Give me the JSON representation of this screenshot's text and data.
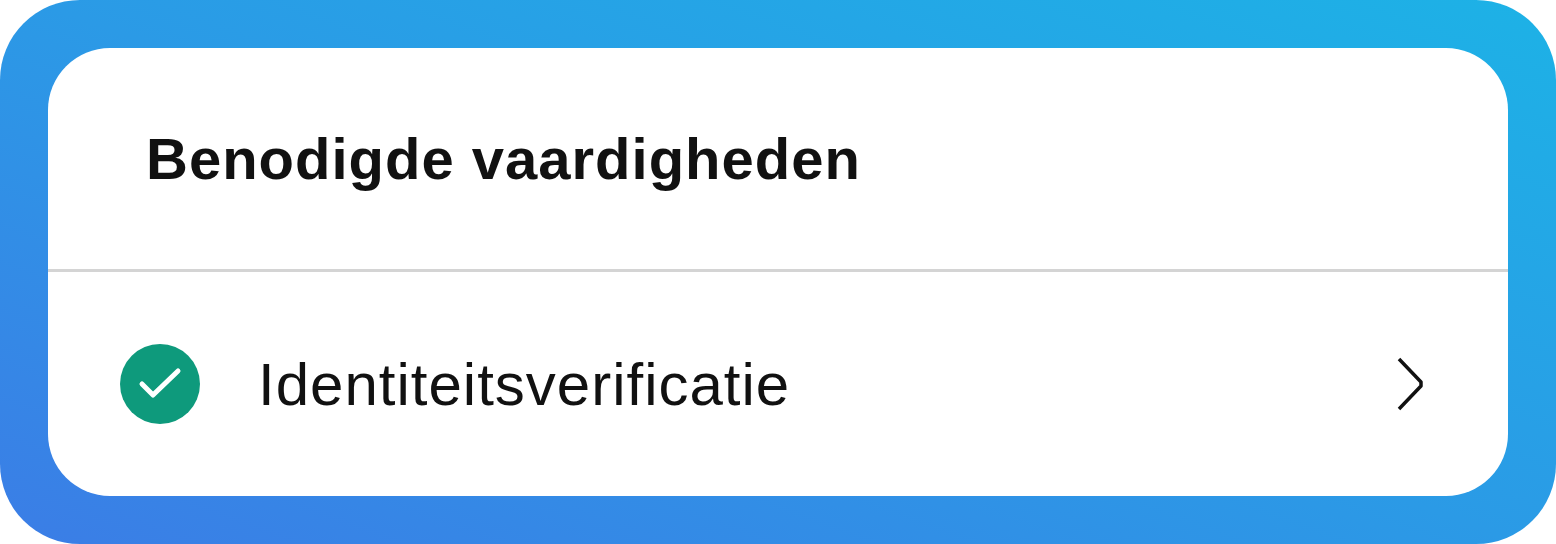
{
  "title": "Benodigde vaardigheden",
  "items": [
    {
      "label": "Identiteitsverificatie",
      "checked": true
    }
  ]
}
